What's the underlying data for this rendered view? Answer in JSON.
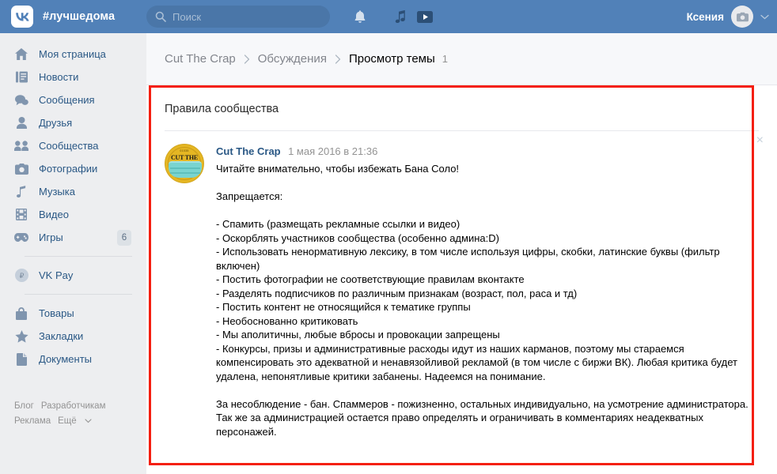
{
  "header": {
    "logo_icon": "vk-logo-icon",
    "brand": "#лучшедома",
    "search": {
      "placeholder": "Поиск",
      "value": "",
      "icon": "search-icon"
    },
    "icons": [
      {
        "name": "bell-icon",
        "label": "Уведомления"
      },
      {
        "name": "music-note-icon",
        "label": "Музыка"
      },
      {
        "name": "video-play-icon",
        "label": "Видео"
      }
    ],
    "user": {
      "name": "Ксения",
      "avatar_icon": "camera-icon",
      "chevron_icon": "chevron-down-icon"
    }
  },
  "sidebar": {
    "items": [
      {
        "label": "Моя страница",
        "icon": "home-icon",
        "badge": ""
      },
      {
        "label": "Новости",
        "icon": "news-icon",
        "badge": ""
      },
      {
        "label": "Сообщения",
        "icon": "message-icon",
        "badge": ""
      },
      {
        "label": "Друзья",
        "icon": "person-icon",
        "badge": ""
      },
      {
        "label": "Сообщества",
        "icon": "people-icon",
        "badge": ""
      },
      {
        "label": "Фотографии",
        "icon": "camera-icon",
        "badge": ""
      },
      {
        "label": "Музыка",
        "icon": "music-note-icon",
        "badge": ""
      },
      {
        "label": "Видео",
        "icon": "film-icon",
        "badge": ""
      },
      {
        "label": "Игры",
        "icon": "gamepad-icon",
        "badge": "6"
      }
    ],
    "vkpay": {
      "label": "VK Pay",
      "icon": "ruble-circle-icon"
    },
    "items2": [
      {
        "label": "Товары",
        "icon": "bag-icon"
      },
      {
        "label": "Закладки",
        "icon": "star-icon"
      },
      {
        "label": "Документы",
        "icon": "document-icon"
      }
    ],
    "footer_links": [
      {
        "label": "Блог"
      },
      {
        "label": "Разработчикам"
      },
      {
        "label": "Реклама"
      },
      {
        "label": "Ещё",
        "icon": "chevron-down-icon"
      }
    ]
  },
  "breadcrumb": {
    "group": "Cut The Crap",
    "section": "Обсуждения",
    "current": "Просмотр темы",
    "count": "1",
    "separator_icon": "chevron-right-icon"
  },
  "topic": {
    "title": "Правила сообщества",
    "close_icon": "close-icon",
    "post": {
      "author": "Cut The Crap",
      "date": "1 мая 2016 в 21:36",
      "avatar_icon": "community-avatar",
      "avatar_top_text": "01035",
      "avatar_name_text": "CUT THE",
      "text": "Читайте внимательно, чтобы избежать Бана Соло!\n\nЗапрещается:\n\n- Спамить (размещать рекламные ссылки и видео)\n- Оскорблять участников сообщества (особенно админа:D)\n- Использовать ненормативную лексику, в том числе используя цифры, скобки, латинские буквы (фильтр включен)\n- Постить фотографии не соответствующие правилам вконтакте\n- Разделять подписчиков по различным признакам (возраст, пол, раса и тд)\n- Постить контент не относящийся к тематике группы\n- Необоснованно критиковать\n- Мы аполитичны, любые вбросы и провокации запрещены\n- Конкурсы, призы и административные расходы идут из наших карманов, поэтому мы стараемся компенсировать это адекватной и ненавязойливой рекламой (в том числе с биржи ВК). Любая критика будет удалена, непонятливые критики забанены. Надеемся на понимание.\n\nЗа несоблюдение - бан. Спаммеров - пожизненно, остальных индивидуально, на усмотрение администратора. Так же за администрацией остается право определять и ограничивать в комментариях неадекватных персонажей."
    }
  },
  "annotation": {
    "color": "#f41f10"
  }
}
